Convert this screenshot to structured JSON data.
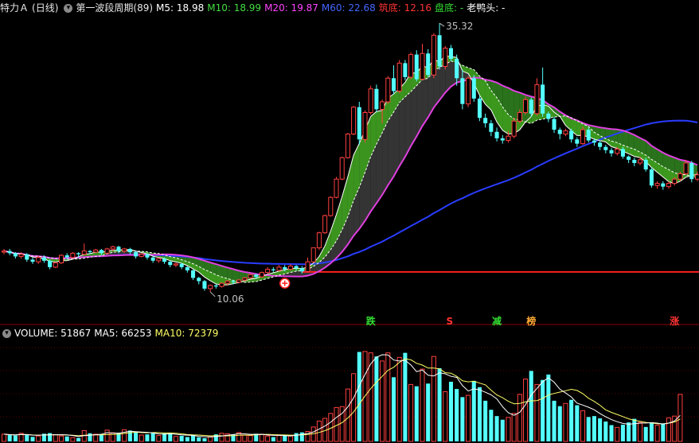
{
  "header": {
    "stock_name": "特力Ａ",
    "period": "(日线)",
    "indicator": "第一波段周期(89)",
    "ma5_label": "M5: 18.98",
    "ma10_label": "M10: 18.99",
    "ma20_label": "M20: 19.87",
    "ma60_label": "M60: 22.68",
    "bottom_label": "筑底: 12.16",
    "pan_label": "盘底: -",
    "duck_label": "老鸭头: -",
    "colors": {
      "ma5": "#ffffff",
      "ma10": "#44dd44",
      "ma20": "#ff44ff",
      "ma60": "#4466ff",
      "bottom": "#ff3333",
      "pan": "#33dd33",
      "duck": "#ffffff"
    }
  },
  "volume_header": {
    "volume_label": "VOLUME: 51867",
    "ma5_label": "MA5: 66253",
    "ma10_label": "MA10: 72379",
    "colors": {
      "volume": "#ffffff",
      "ma5": "#ffffff",
      "ma10": "#ffff66"
    }
  },
  "chart_data": {
    "type": "candlestick",
    "price_ylim": [
      8,
      36
    ],
    "high_annotation": "35.32",
    "low_annotation": "10.06",
    "support_level": 12.16,
    "signals": [
      {
        "index": 64,
        "text": "跌",
        "color": "#33dd33"
      },
      {
        "index": 78,
        "text": "S",
        "color": "#ff3333"
      },
      {
        "index": 86,
        "text": "减",
        "color": "#33dd33"
      },
      {
        "index": 92,
        "text": "榜",
        "color": "#ffaa33"
      },
      {
        "index": 117,
        "text": "涨",
        "color": "#ff3333"
      }
    ],
    "buy_marker_index": 53,
    "candles": [
      [
        14.0,
        14.1,
        14.3,
        13.8
      ],
      [
        14.1,
        13.9,
        14.3,
        13.7
      ],
      [
        13.9,
        13.6,
        14.0,
        13.4
      ],
      [
        13.6,
        13.8,
        14.0,
        13.4
      ],
      [
        13.8,
        13.3,
        13.9,
        13.1
      ],
      [
        13.3,
        13.1,
        13.5,
        12.9
      ],
      [
        13.1,
        13.5,
        13.7,
        12.9
      ],
      [
        13.5,
        13.2,
        13.7,
        13.0
      ],
      [
        13.2,
        12.6,
        13.3,
        12.4
      ],
      [
        12.6,
        13.0,
        13.1,
        12.5
      ],
      [
        13.0,
        13.7,
        13.8,
        12.9
      ],
      [
        13.7,
        13.5,
        13.9,
        13.3
      ],
      [
        13.5,
        13.9,
        14.0,
        13.4
      ],
      [
        13.9,
        13.8,
        14.0,
        13.5
      ],
      [
        13.8,
        14.1,
        14.8,
        13.7
      ],
      [
        14.1,
        14.0,
        14.2,
        13.8
      ],
      [
        14.0,
        14.2,
        14.3,
        13.9
      ],
      [
        14.2,
        13.9,
        14.3,
        13.7
      ],
      [
        13.9,
        14.3,
        14.4,
        13.8
      ],
      [
        14.3,
        14.5,
        14.6,
        14.1
      ],
      [
        14.5,
        14.1,
        14.6,
        13.9
      ],
      [
        14.1,
        14.3,
        14.4,
        13.9
      ],
      [
        14.3,
        14.0,
        14.4,
        13.8
      ],
      [
        14.0,
        13.6,
        14.1,
        13.4
      ],
      [
        13.6,
        13.8,
        13.9,
        13.5
      ],
      [
        13.8,
        13.5,
        13.9,
        13.3
      ],
      [
        13.5,
        13.2,
        13.6,
        13.0
      ],
      [
        13.2,
        13.4,
        13.5,
        13.0
      ],
      [
        13.4,
        13.1,
        13.5,
        12.9
      ],
      [
        13.1,
        12.8,
        13.2,
        12.6
      ],
      [
        12.8,
        12.9,
        13.0,
        12.6
      ],
      [
        12.9,
        12.6,
        13.0,
        12.4
      ],
      [
        12.6,
        12.3,
        12.7,
        12.1
      ],
      [
        12.3,
        11.6,
        12.4,
        11.4
      ],
      [
        11.6,
        11.3,
        11.7,
        11.0
      ],
      [
        11.3,
        10.6,
        11.4,
        10.4
      ],
      [
        10.6,
        10.9,
        11.0,
        10.3
      ],
      [
        10.9,
        10.8,
        11.0,
        10.6
      ],
      [
        10.8,
        11.1,
        11.2,
        10.7
      ],
      [
        11.1,
        11.3,
        11.4,
        10.9
      ],
      [
        11.3,
        11.2,
        11.4,
        11.0
      ],
      [
        11.2,
        11.4,
        11.5,
        11.1
      ],
      [
        11.4,
        11.6,
        11.7,
        11.3
      ],
      [
        11.6,
        11.9,
        12.0,
        11.5
      ],
      [
        11.9,
        11.7,
        12.0,
        11.5
      ],
      [
        11.7,
        12.1,
        12.2,
        11.6
      ],
      [
        12.1,
        12.4,
        12.6,
        12.0
      ],
      [
        12.4,
        12.3,
        12.6,
        12.1
      ],
      [
        12.3,
        12.6,
        12.8,
        12.2
      ],
      [
        12.6,
        12.4,
        12.8,
        12.2
      ],
      [
        12.4,
        12.7,
        12.9,
        12.3
      ],
      [
        12.7,
        12.5,
        12.8,
        12.3
      ],
      [
        12.5,
        12.2,
        12.7,
        12.0
      ],
      [
        12.2,
        13.1,
        13.5,
        12.1
      ],
      [
        13.1,
        14.4,
        14.4,
        13.0
      ],
      [
        14.4,
        15.8,
        15.9,
        14.2
      ],
      [
        15.8,
        17.4,
        17.5,
        15.7
      ],
      [
        17.4,
        19.1,
        19.2,
        17.3
      ],
      [
        19.1,
        20.8,
        21.0,
        19.0
      ],
      [
        20.8,
        22.8,
        22.9,
        20.7
      ],
      [
        22.8,
        25.0,
        25.1,
        22.7
      ],
      [
        25.0,
        27.5,
        27.6,
        24.9
      ],
      [
        27.5,
        24.5,
        28.0,
        24.0
      ],
      [
        24.5,
        27.0,
        27.2,
        24.2
      ],
      [
        27.0,
        29.2,
        29.5,
        26.8
      ],
      [
        29.2,
        27.3,
        29.6,
        27.0
      ],
      [
        27.3,
        28.0,
        28.2,
        26.0
      ],
      [
        28.0,
        30.2,
        30.4,
        27.8
      ],
      [
        30.2,
        29.0,
        31.4,
        28.7
      ],
      [
        29.0,
        31.6,
        31.9,
        28.8
      ],
      [
        31.6,
        30.3,
        31.9,
        30.0
      ],
      [
        30.3,
        32.4,
        32.6,
        30.1
      ],
      [
        32.4,
        30.1,
        32.8,
        29.9
      ],
      [
        30.1,
        32.5,
        33.4,
        30.0
      ],
      [
        32.5,
        30.5,
        32.9,
        30.3
      ],
      [
        30.5,
        34.2,
        34.4,
        30.2
      ],
      [
        34.2,
        31.3,
        35.32,
        31.0
      ],
      [
        31.3,
        33.0,
        33.2,
        31.0
      ],
      [
        33.0,
        32.0,
        33.3,
        31.8
      ],
      [
        32.0,
        30.2,
        32.4,
        29.5
      ],
      [
        30.2,
        27.8,
        31.0,
        27.3
      ],
      [
        27.8,
        30.2,
        30.4,
        27.5
      ],
      [
        30.2,
        28.3,
        30.5,
        28.0
      ],
      [
        28.3,
        26.5,
        28.6,
        26.2
      ],
      [
        26.5,
        26.0,
        26.9,
        25.6
      ],
      [
        26.0,
        25.2,
        26.3,
        24.8
      ],
      [
        25.2,
        24.6,
        25.6,
        24.3
      ],
      [
        24.6,
        24.4,
        24.9,
        24.1
      ],
      [
        24.4,
        24.8,
        25.3,
        24.2
      ],
      [
        24.8,
        26.2,
        26.5,
        24.6
      ],
      [
        26.2,
        27.0,
        27.3,
        26.0
      ],
      [
        27.0,
        28.2,
        28.5,
        26.8
      ],
      [
        28.2,
        26.9,
        28.4,
        26.6
      ],
      [
        26.9,
        29.6,
        30.2,
        26.7
      ],
      [
        29.6,
        26.9,
        31.2,
        26.6
      ],
      [
        26.9,
        26.4,
        27.1,
        26.1
      ],
      [
        26.4,
        25.4,
        26.6,
        25.1
      ],
      [
        25.4,
        25.0,
        25.6,
        24.5
      ],
      [
        25.0,
        25.3,
        25.5,
        24.8
      ],
      [
        25.3,
        24.5,
        25.5,
        24.2
      ],
      [
        24.5,
        24.1,
        24.7,
        23.8
      ],
      [
        24.1,
        25.4,
        25.7,
        24.0
      ],
      [
        25.4,
        24.4,
        25.6,
        24.2
      ],
      [
        24.4,
        24.2,
        24.6,
        23.9
      ],
      [
        24.2,
        23.8,
        24.4,
        23.5
      ],
      [
        23.8,
        23.5,
        24.0,
        23.2
      ],
      [
        23.5,
        23.2,
        23.7,
        22.9
      ],
      [
        23.2,
        23.6,
        23.8,
        23.0
      ],
      [
        23.6,
        22.9,
        23.8,
        22.7
      ],
      [
        22.9,
        22.6,
        23.0,
        22.3
      ],
      [
        22.6,
        22.3,
        22.8,
        22.0
      ],
      [
        22.3,
        22.6,
        22.9,
        22.1
      ],
      [
        22.6,
        21.7,
        22.8,
        21.5
      ],
      [
        21.7,
        20.2,
        21.9,
        20.0
      ],
      [
        20.2,
        20.4,
        20.6,
        19.9
      ],
      [
        20.4,
        20.1,
        20.6,
        19.8
      ],
      [
        20.1,
        20.4,
        20.6,
        19.9
      ],
      [
        20.4,
        20.8,
        21.0,
        20.2
      ],
      [
        20.8,
        21.3,
        21.5,
        20.6
      ],
      [
        21.3,
        22.3,
        22.6,
        21.2
      ],
      [
        22.3,
        20.8,
        22.5,
        20.5
      ],
      [
        20.8,
        21.2,
        21.5,
        20.6
      ]
    ],
    "volumes": [
      8000,
      7000,
      6500,
      9000,
      7200,
      5000,
      6000,
      8500,
      9200,
      7500,
      6000,
      5500,
      4200,
      3800,
      12000,
      9000,
      8000,
      7000,
      12500,
      9500,
      8800,
      13000,
      12000,
      10500,
      7000,
      7800,
      9500,
      6500,
      8800,
      9500,
      5500,
      6200,
      4800,
      7000,
      4500,
      3500,
      5000,
      7800,
      9000,
      8500,
      7500,
      9800,
      7000,
      6500,
      8500,
      7600,
      6000,
      4800,
      6500,
      7200,
      6000,
      9200,
      10000,
      11000,
      16000,
      22500,
      25500,
      31000,
      37500,
      38500,
      58000,
      75000,
      99000,
      99500,
      98000,
      94000,
      89000,
      98000,
      71000,
      93000,
      98000,
      63000,
      61000,
      80000,
      64000,
      94000,
      81000,
      55000,
      66000,
      58000,
      49000,
      51000,
      67000,
      60000,
      45000,
      35000,
      28000,
      24000,
      26500,
      31000,
      52000,
      69000,
      78000,
      63000,
      68000,
      74000,
      45000,
      39000,
      42000,
      46000,
      40000,
      34000,
      27000,
      28000,
      25500,
      22000,
      18000,
      15500,
      18500,
      21000,
      25000,
      21000,
      16000,
      21000,
      18000,
      20000,
      26000,
      28000,
      52000
    ],
    "volume_ylim": [
      0,
      110000
    ]
  }
}
